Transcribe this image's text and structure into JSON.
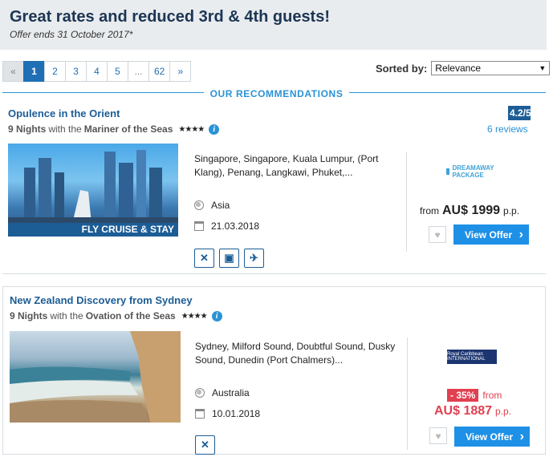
{
  "promo": {
    "title": "Great rates and reduced 3rd & 4th guests!",
    "subtitle": "Offer ends 31 October 2017*"
  },
  "pagination": {
    "prev": "«",
    "pages": [
      "1",
      "2",
      "3",
      "4",
      "5",
      "...",
      "62"
    ],
    "active": "1",
    "next": "»"
  },
  "sort": {
    "label": "Sorted by:",
    "selected": "Relevance"
  },
  "section_title": "OUR RECOMMENDATIONS",
  "cruises": [
    {
      "title": "Opulence in the Orient",
      "nights": "9 Nights",
      "with_text": "with the",
      "ship": "Mariner of the Seas",
      "stars": "★★★★",
      "rating": "4.2/5",
      "reviews": "6 reviews",
      "banner": "FLY CRUISE & STAY",
      "route": "Singapore, Singapore, Kuala Lumpur, (Port Klang), Penang, Langkawi, Phuket,...",
      "region": "Asia",
      "date": "21.03.2018",
      "partner": "DREAMAWAY PACKAGE",
      "price_from": "from",
      "price": "AU$ 1999",
      "price_unit": "p.p.",
      "offer_button": "View Offer",
      "amenities": [
        "dining-icon",
        "excursion-icon",
        "flight-icon"
      ]
    },
    {
      "title": "New Zealand Discovery from Sydney",
      "nights": "9 Nights",
      "with_text": "with the",
      "ship": "Ovation of the Seas",
      "stars": "★★★★",
      "route": "Sydney, Milford Sound, Doubtful Sound, Dusky Sound, Dunedin (Port Chalmers)...",
      "region": "Australia",
      "date": "10.01.2018",
      "partner": "Royal Caribbean INTERNATIONAL",
      "discount": "- 35%",
      "price_from": "from",
      "price": "AU$ 1887",
      "price_unit": "p.p.",
      "offer_button": "View Offer",
      "amenities": [
        "dining-icon"
      ]
    }
  ],
  "colors": {
    "brand_navy": "#1c5d96",
    "accent_blue": "#1e90e6",
    "discount_red": "#e04050"
  }
}
